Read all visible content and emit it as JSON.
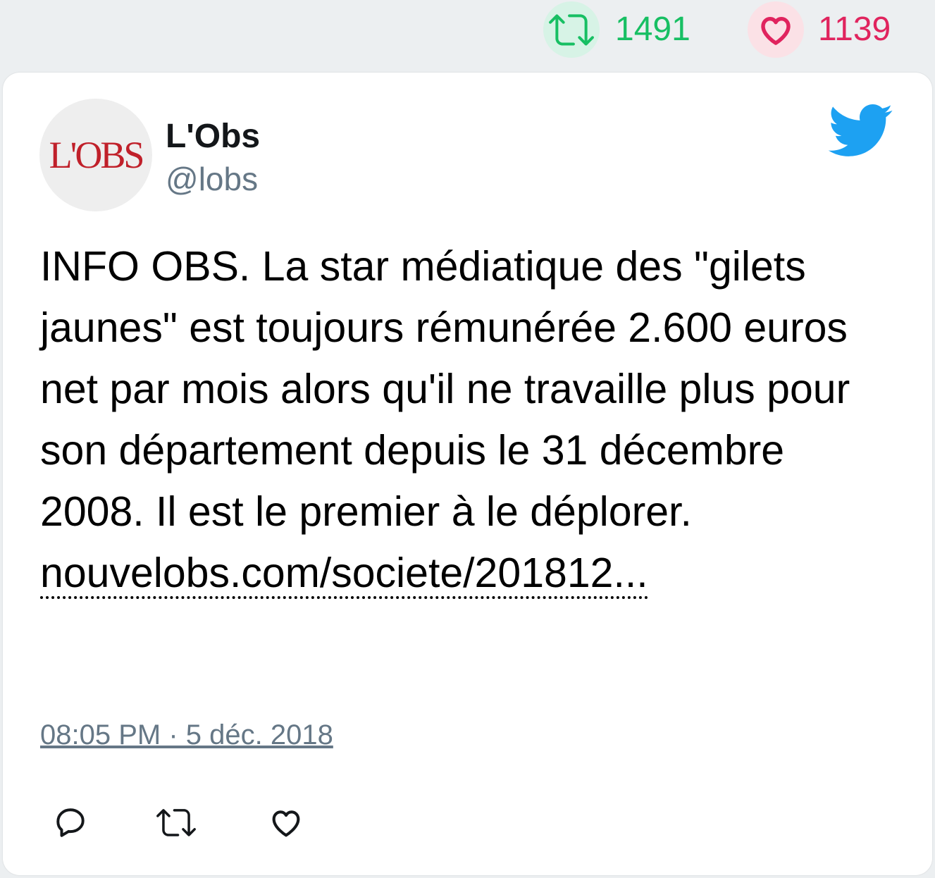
{
  "stats": {
    "retweets": "1491",
    "likes": "1139",
    "retweet_color": "#17bf63",
    "like_color": "#e0245e"
  },
  "tweet": {
    "avatar_text": "L'OBS",
    "author_name": "L'Obs",
    "author_handle": "@lobs",
    "text": "INFO OBS. La star médiatique des \"gilets jaunes\" est toujours rémunérée 2.600 euros net par mois alors qu'il ne travaille plus pour son département depuis le 31 décembre 2008. Il est le premier à le déplorer.",
    "link_text": "nouvelobs.com/societe/201812...",
    "timestamp": "08:05 PM · 5 déc. 2018"
  },
  "icons": {
    "brand": "twitter-bird-icon",
    "reply": "reply-icon",
    "retweet": "retweet-icon",
    "like": "heart-icon"
  },
  "colors": {
    "brand_blue": "#1da1f2",
    "muted": "#657786",
    "avatar_red": "#c0202a"
  }
}
